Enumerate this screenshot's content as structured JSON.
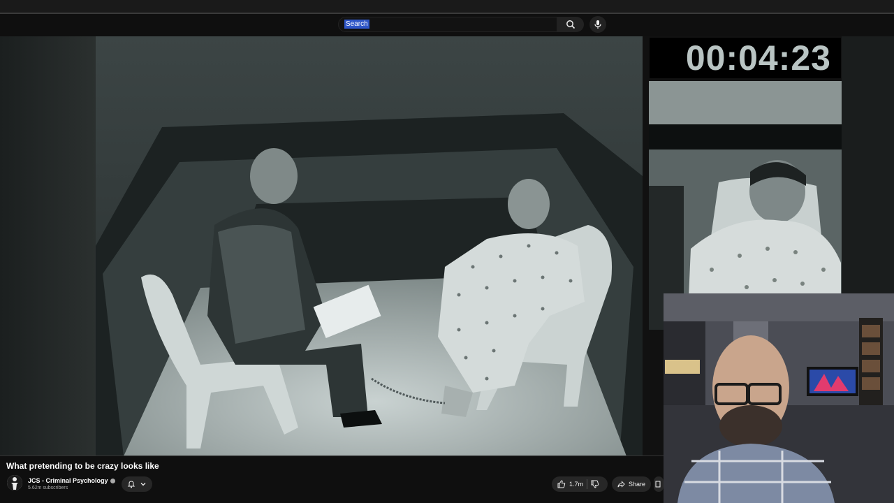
{
  "search": {
    "placeholder": "Search"
  },
  "player": {
    "timer": "00:04:23"
  },
  "video": {
    "title": "What pretending to be crazy looks like",
    "channel": "JCS - Criminal Psychology",
    "subscribers": "5.62m subscribers",
    "likes": "1.7m",
    "share_label": "Share"
  },
  "icons": {
    "search": "search-icon",
    "mic": "mic-icon",
    "bell": "bell-icon",
    "chevron": "chevron-down-icon",
    "like": "thumbs-up-icon",
    "dislike": "thumbs-down-icon",
    "share": "share-icon",
    "verified": "verified-icon"
  },
  "colors": {
    "background": "#0f0f0f",
    "search_highlight": "#2f56c7",
    "button": "#272727"
  }
}
